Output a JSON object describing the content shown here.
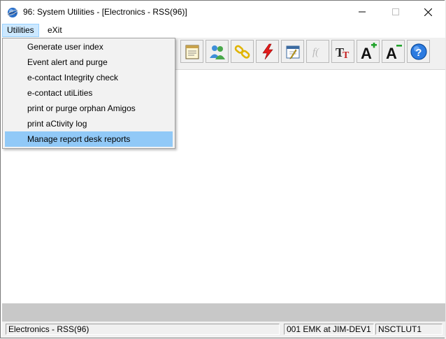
{
  "window": {
    "title": "96: System Utilities - [Electronics - RSS(96)]"
  },
  "menubar": {
    "items": [
      {
        "label": "Utilities"
      },
      {
        "label": "eXit"
      }
    ]
  },
  "dropdown": {
    "items": [
      {
        "label": "Generate user index"
      },
      {
        "label": "Event alert and purge"
      },
      {
        "label": "e-contact Integrity check"
      },
      {
        "label": "e-contact utiLities"
      },
      {
        "label": "print or purge orphan Amigos"
      },
      {
        "label": "print aCtivity log"
      },
      {
        "label": "Manage report desk reports"
      }
    ],
    "highlighted_index": 6
  },
  "toolbar": {
    "buttons": [
      {
        "icon": "notepad-icon"
      },
      {
        "icon": "users-icon"
      },
      {
        "icon": "chain-link-icon"
      },
      {
        "icon": "lightning-icon"
      },
      {
        "icon": "calendar-edit-icon"
      },
      {
        "icon": "function-icon"
      },
      {
        "icon": "font-size-icon",
        "label": "TT"
      },
      {
        "icon": "font-increase-icon",
        "label": "A"
      },
      {
        "icon": "font-decrease-icon",
        "label": "A"
      },
      {
        "icon": "help-icon",
        "label": "?"
      }
    ]
  },
  "statusbar": {
    "panels": [
      {
        "label": "Electronics - RSS(96)"
      },
      {
        "label": "001 EMK at JIM-DEV1"
      },
      {
        "label": "NSCTLUT1"
      }
    ]
  },
  "colors": {
    "menu_highlight": "#91c9f7",
    "menu_active": "#cce8ff",
    "toolbar_bg": "#f0f0f0",
    "graybar": "#c8c8c8"
  }
}
